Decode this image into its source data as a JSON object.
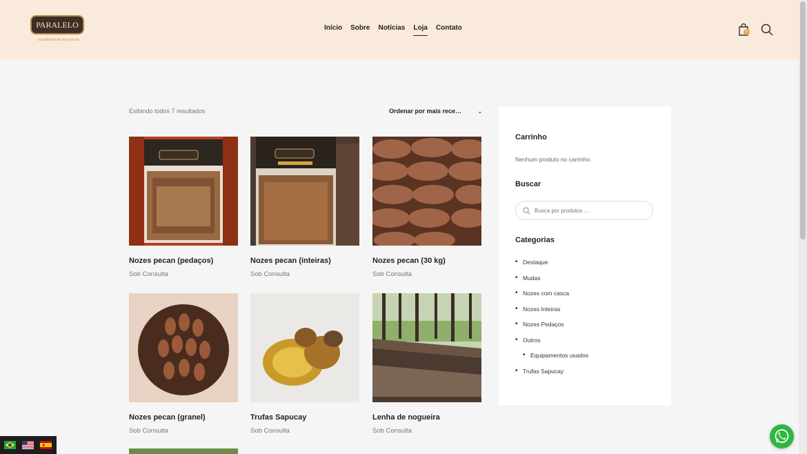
{
  "header": {
    "logo_text": "PARALELO 30",
    "logo_tagline": "excelência em noz pecan",
    "nav": [
      {
        "label": "Início"
      },
      {
        "label": "Sobre"
      },
      {
        "label": "Notícias"
      },
      {
        "label": "Loja",
        "active": true
      },
      {
        "label": "Contato"
      }
    ],
    "cart_count": "0",
    "icons": {
      "cart": "shopping-bag-icon",
      "search": "search-icon"
    }
  },
  "shop": {
    "result_count": "Exibindo todos 7 resultados",
    "ordering_label": "Ordenar por mais rece…",
    "products": [
      {
        "title": "Nozes pecan (pedaços)",
        "price": "Sob Consulta"
      },
      {
        "title": "Nozes pecan (inteiras)",
        "price": "Sob Consulta"
      },
      {
        "title": "Nozes pecan (30 kg)",
        "price": "Sob Consulta"
      },
      {
        "title": "Nozes pecan (granel)",
        "price": "Sob Consulta"
      },
      {
        "title": "Trufas Sapucay",
        "price": "Sob Consulta"
      },
      {
        "title": "Lenha de nogueira",
        "price": "Sob Consulta"
      }
    ]
  },
  "sidebar": {
    "cart_title": "Carrinho",
    "cart_empty": "Nenhum produto no carrinho.",
    "search_title": "Buscar",
    "search_placeholder": "Busca por produtos …",
    "categories_title": "Categorias",
    "categories": [
      {
        "label": "Destaque"
      },
      {
        "label": "Mudas"
      },
      {
        "label": "Nozes com casca"
      },
      {
        "label": "Nozes Inteiras"
      },
      {
        "label": "Nozes Pedaços"
      },
      {
        "label": "Outros"
      },
      {
        "label": "Equipamentos usados",
        "child": true
      },
      {
        "label": "Trufas Sapucay"
      }
    ]
  },
  "language_switcher": [
    "Português (Brasil)",
    "English (US)",
    "Español"
  ],
  "colors": {
    "header_bg": "#faeadb",
    "accent": "#e6a53a",
    "whatsapp": "#2db742"
  }
}
